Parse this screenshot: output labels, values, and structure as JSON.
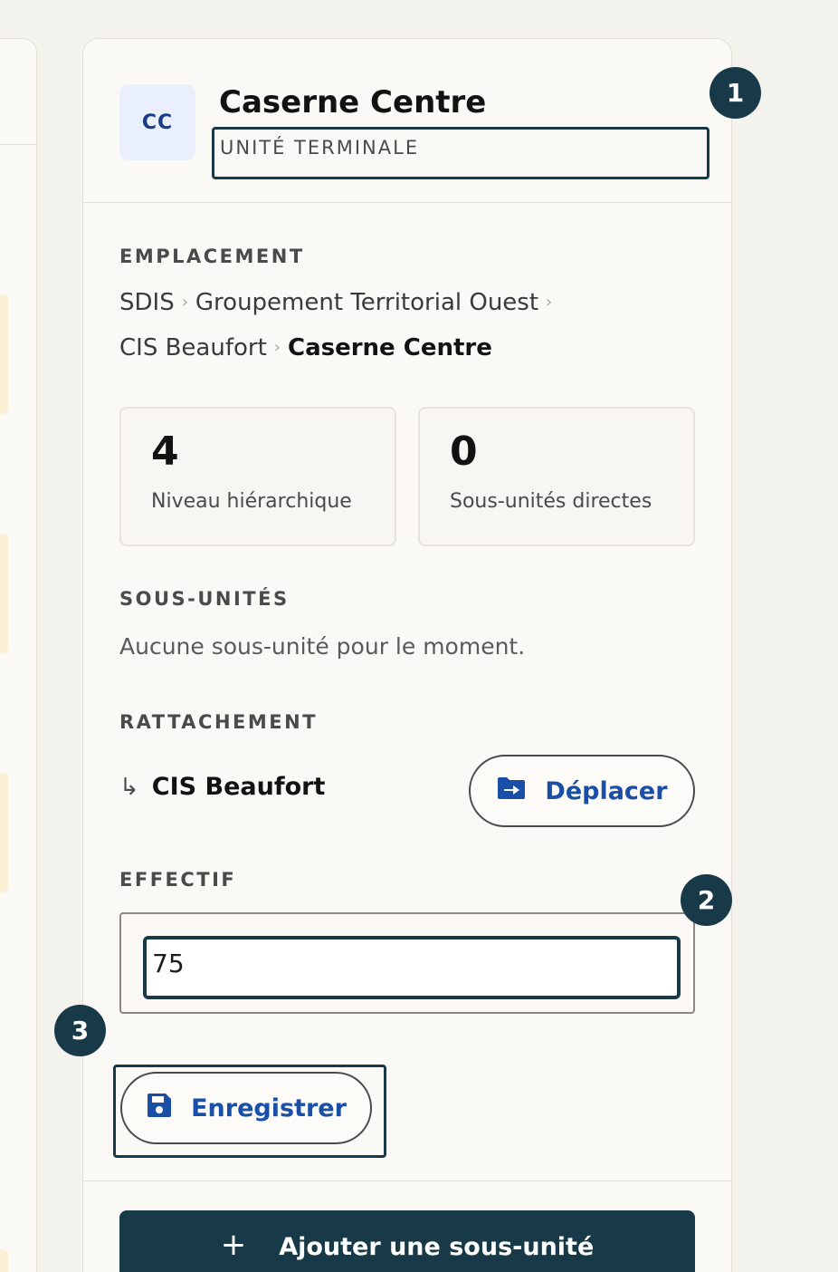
{
  "unit": {
    "initials": "CC",
    "title": "Caserne Centre",
    "type_label": "UNITÉ TERMINALE"
  },
  "location": {
    "label": "EMPLACEMENT",
    "crumbs": [
      "SDIS",
      "Groupement Territorial Ouest",
      "CIS Beaufort",
      "Caserne Centre"
    ]
  },
  "stats": [
    {
      "value": "4",
      "label": "Niveau hiérarchique"
    },
    {
      "value": "0",
      "label": "Sous-unités directes"
    }
  ],
  "subunits": {
    "label": "SOUS-UNITÉS",
    "empty_text": "Aucune sous-unité pour le moment."
  },
  "attachment": {
    "label": "RATTACHEMENT",
    "parent_name": "CIS Beaufort",
    "arrow_glyph": "↳",
    "move_label": "Déplacer"
  },
  "staff": {
    "label": "EFFECTIF",
    "value": "75",
    "save_label": "Enregistrer"
  },
  "add_subunit": {
    "plus_glyph": "+",
    "label": "Ajouter une sous-unité"
  },
  "markers": [
    "1",
    "2",
    "3"
  ],
  "colors": {
    "accent_dark": "#173948",
    "link_blue": "#1a4fa8",
    "avatar_bg": "#eaf0fb"
  }
}
